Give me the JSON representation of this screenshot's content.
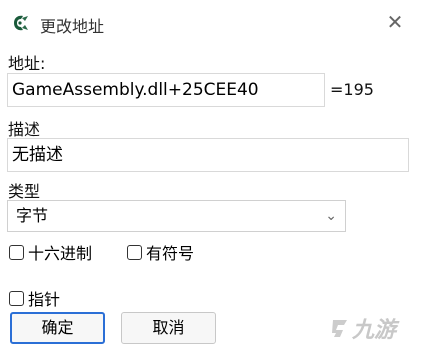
{
  "window": {
    "title": "更改地址",
    "close_label": "✕"
  },
  "address": {
    "label": "地址:",
    "value": "GameAssembly.dll+25CEE40",
    "resolved": "=195"
  },
  "description": {
    "label": "描述",
    "value": "无描述"
  },
  "type": {
    "label": "类型",
    "selected": "字节"
  },
  "options": {
    "hex": "十六进制",
    "signed": "有符号",
    "pointer": "指针"
  },
  "buttons": {
    "ok": "确定",
    "cancel": "取消"
  },
  "watermark": {
    "text": "九游"
  }
}
